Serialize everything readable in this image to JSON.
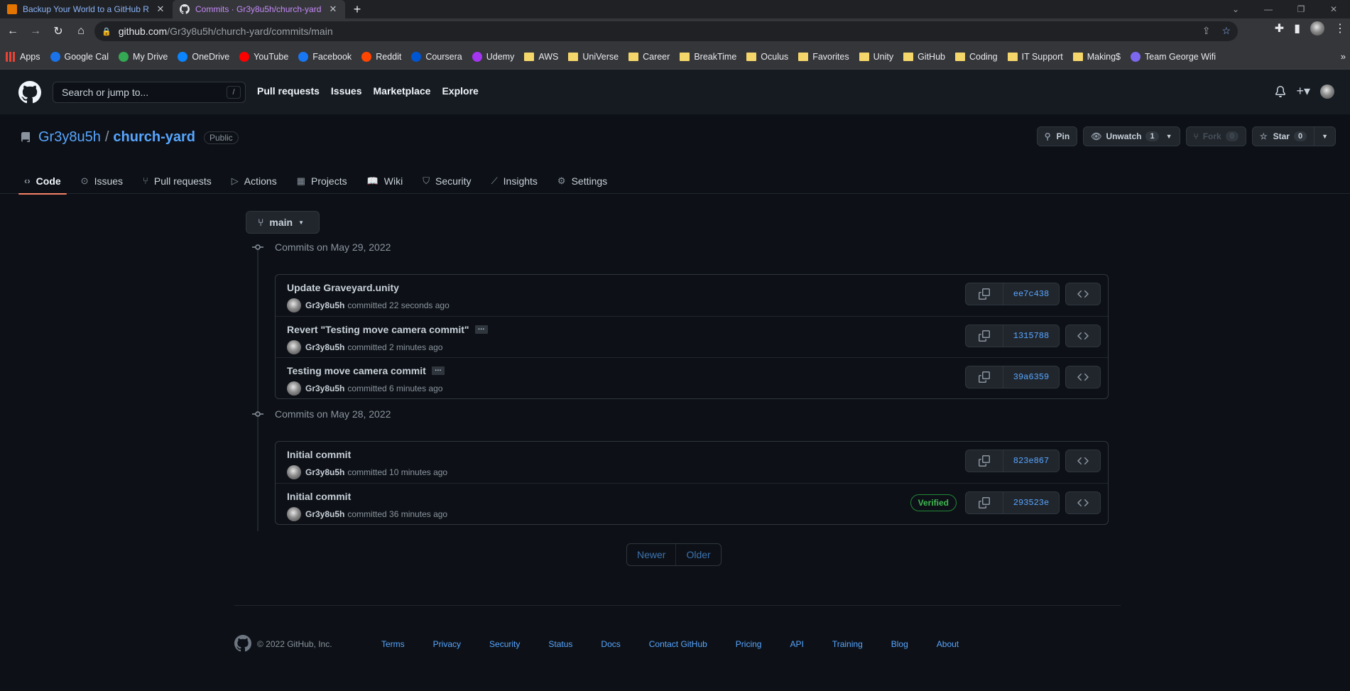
{
  "browser": {
    "tabs": [
      {
        "title": "Backup Your World to a GitHub R",
        "close": "✕"
      },
      {
        "title": "Commits · Gr3y8u5h/church-yard",
        "close": "✕"
      }
    ],
    "new_tab": "+",
    "url_host": "github.com",
    "url_path": "/Gr3y8u5h/church-yard/commits/main",
    "bookmarks": [
      {
        "label": "Apps",
        "kind": "apps"
      },
      {
        "label": "Google Cal",
        "kind": "icon",
        "color": "#1a73e8"
      },
      {
        "label": "My Drive",
        "kind": "icon",
        "color": "#34a853"
      },
      {
        "label": "OneDrive",
        "kind": "icon",
        "color": "#0a84ff"
      },
      {
        "label": "YouTube",
        "kind": "icon",
        "color": "#ff0000"
      },
      {
        "label": "Facebook",
        "kind": "icon",
        "color": "#1877f2"
      },
      {
        "label": "Reddit",
        "kind": "icon",
        "color": "#ff4500"
      },
      {
        "label": "Coursera",
        "kind": "icon",
        "color": "#0056d2"
      },
      {
        "label": "Udemy",
        "kind": "icon",
        "color": "#a435f0"
      },
      {
        "label": "AWS",
        "kind": "folder"
      },
      {
        "label": "UniVerse",
        "kind": "folder"
      },
      {
        "label": "Career",
        "kind": "folder"
      },
      {
        "label": "BreakTime",
        "kind": "folder"
      },
      {
        "label": "Oculus",
        "kind": "folder"
      },
      {
        "label": "Favorites",
        "kind": "folder"
      },
      {
        "label": "Unity",
        "kind": "folder"
      },
      {
        "label": "GitHub",
        "kind": "folder"
      },
      {
        "label": "Coding",
        "kind": "folder"
      },
      {
        "label": "IT Support",
        "kind": "folder"
      },
      {
        "label": "Making$",
        "kind": "folder"
      },
      {
        "label": "Team George Wifi",
        "kind": "icon",
        "color": "#7b68ee"
      }
    ]
  },
  "github": {
    "search_placeholder": "Search or jump to...",
    "search_key": "/",
    "nav": [
      "Pull requests",
      "Issues",
      "Marketplace",
      "Explore"
    ]
  },
  "repo": {
    "owner": "Gr3y8u5h",
    "separator": "/",
    "name": "church-yard",
    "visibility": "Public",
    "pin_label": "Pin",
    "watch_label": "Unwatch",
    "watch_count": "1",
    "fork_label": "Fork",
    "fork_count": "0",
    "star_label": "Star",
    "star_count": "0",
    "tabs": [
      {
        "label": "Code",
        "icon": "code-icon",
        "glyph": "‹›"
      },
      {
        "label": "Issues",
        "icon": "issue-icon",
        "glyph": "⊙"
      },
      {
        "label": "Pull requests",
        "icon": "pull-request-icon",
        "glyph": "⑂"
      },
      {
        "label": "Actions",
        "icon": "play-icon",
        "glyph": "▷"
      },
      {
        "label": "Projects",
        "icon": "table-icon",
        "glyph": "▦"
      },
      {
        "label": "Wiki",
        "icon": "book-icon",
        "glyph": "📖"
      },
      {
        "label": "Security",
        "icon": "shield-icon",
        "glyph": "⛉"
      },
      {
        "label": "Insights",
        "icon": "graph-icon",
        "glyph": "⟋"
      },
      {
        "label": "Settings",
        "icon": "gear-icon",
        "glyph": "⚙"
      }
    ]
  },
  "branch": "main",
  "groups": [
    {
      "date": "Commits on May 29, 2022",
      "commits": [
        {
          "message": "Update Graveyard.unity",
          "more": false,
          "author": "Gr3y8u5h",
          "when": "committed 22 seconds ago",
          "sha": "ee7c438",
          "verified": false
        },
        {
          "message": "Revert \"Testing move camera commit\"",
          "more": true,
          "author": "Gr3y8u5h",
          "when": "committed 2 minutes ago",
          "sha": "1315788",
          "verified": false
        },
        {
          "message": "Testing move camera commit",
          "more": true,
          "author": "Gr3y8u5h",
          "when": "committed 6 minutes ago",
          "sha": "39a6359",
          "verified": false
        }
      ]
    },
    {
      "date": "Commits on May 28, 2022",
      "commits": [
        {
          "message": "Initial commit",
          "more": false,
          "author": "Gr3y8u5h",
          "when": "committed 10 minutes ago",
          "sha": "823e867",
          "verified": false
        },
        {
          "message": "Initial commit",
          "more": false,
          "author": "Gr3y8u5h",
          "when": "committed 36 minutes ago",
          "sha": "293523e",
          "verified": true
        }
      ]
    }
  ],
  "verified_label": "Verified",
  "more_label": "…",
  "pager": {
    "newer": "Newer",
    "older": "Older"
  },
  "footer": {
    "copyright": "© 2022 GitHub, Inc.",
    "links": [
      "Terms",
      "Privacy",
      "Security",
      "Status",
      "Docs",
      "Contact GitHub",
      "Pricing",
      "API",
      "Training",
      "Blog",
      "About"
    ]
  }
}
